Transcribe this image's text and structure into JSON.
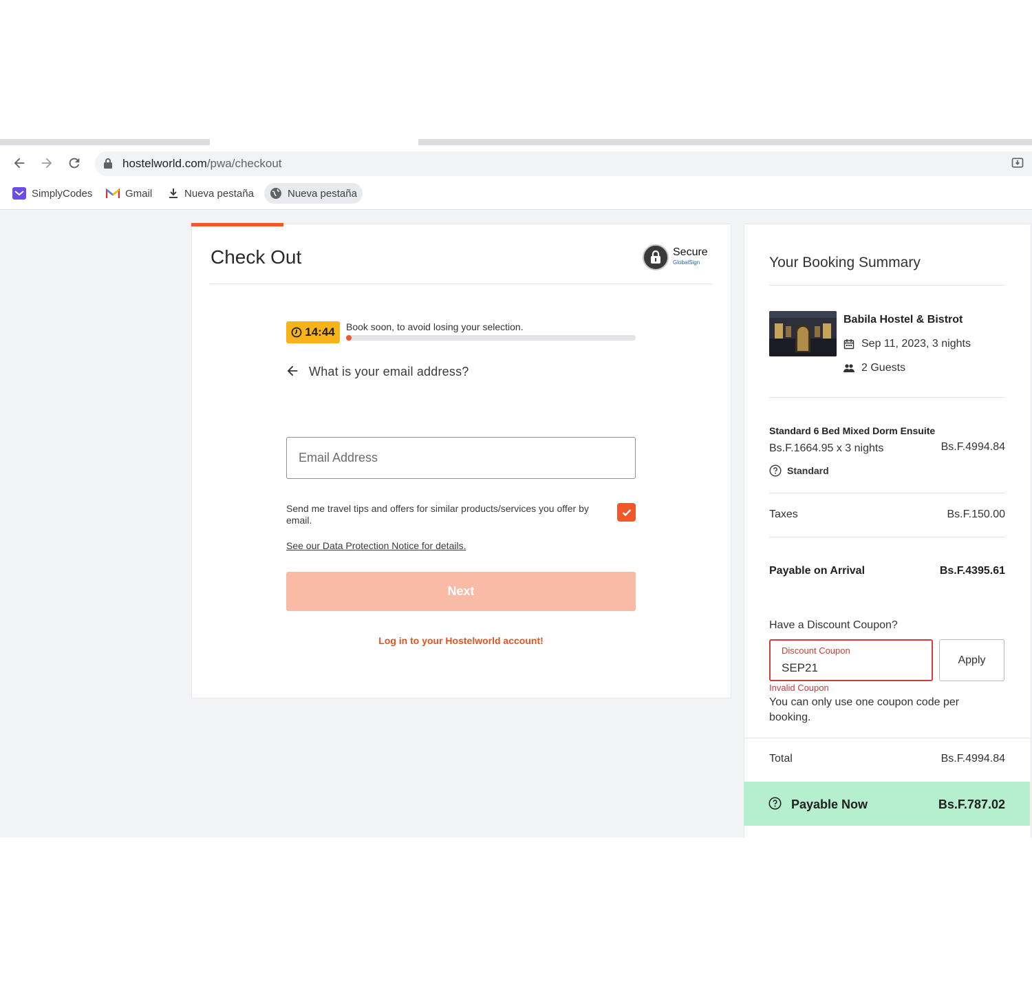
{
  "browser": {
    "url_host": "hostelworld.com",
    "url_path": "/pwa/checkout",
    "bookmarks": [
      {
        "label": "SimplyCodes",
        "icon": "simplycodes-icon"
      },
      {
        "label": "Gmail",
        "icon": "gmail-icon"
      },
      {
        "label": "Nueva pestaña",
        "icon": "download-icon"
      },
      {
        "label": "Nueva pestaña",
        "icon": "globe-icon"
      }
    ]
  },
  "checkout": {
    "title": "Check Out",
    "secure": "Secure",
    "secure_sub": "GlobalSign",
    "timer": "14:44",
    "timer_message": "Book soon, to avoid losing your selection.",
    "timer_progress": 0.02,
    "question": "What is your email address?",
    "email_placeholder": "Email Address",
    "optin_text": "Send me travel tips and offers for similar products/services you offer by email.",
    "optin_checked": true,
    "data_protection_link": "See our Data Protection Notice for details.",
    "next_label": "Next",
    "login_link": "Log in to your Hostelworld account!"
  },
  "summary": {
    "title": "Your Booking Summary",
    "hostel_name": "Babila Hostel & Bistrot",
    "dates": "Sep 11, 2023, 3 nights",
    "guests": "2 Guests",
    "room_name": "Standard 6 Bed Mixed Dorm Ensuite",
    "room_calc": "Bs.F.1664.95 x 3 nights",
    "room_price": "Bs.F.4994.84",
    "rate_type": "Standard",
    "taxes_label": "Taxes",
    "taxes_value": "Bs.F.150.00",
    "arrival_label": "Payable on Arrival",
    "arrival_value": "Bs.F.4395.61",
    "coupon_question": "Have a Discount Coupon?",
    "coupon_label": "Discount Coupon",
    "coupon_value": "SEP21",
    "apply_label": "Apply",
    "coupon_error": "Invalid Coupon",
    "coupon_note": "You can only use one coupon code per booking.",
    "total_label": "Total",
    "total_value": "Bs.F.4994.84",
    "payable_now_label": "Payable Now",
    "payable_now_value": "Bs.F.787.02"
  },
  "colors": {
    "brand_orange": "#f2572b",
    "timer_yellow": "#f9b31a",
    "payable_green": "#b6efce",
    "error_red": "#d23a3a"
  }
}
